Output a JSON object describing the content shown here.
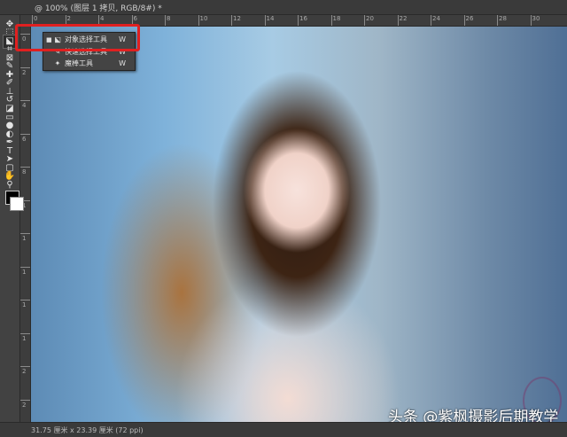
{
  "document": {
    "tab_title": "@ 100% (图层 1 拷贝, RGB/8#) *"
  },
  "ruler": {
    "top_labels": [
      "0",
      "2",
      "4",
      "6",
      "8",
      "10",
      "12",
      "14",
      "16",
      "18",
      "20",
      "22",
      "24",
      "26",
      "28",
      "30"
    ],
    "left_labels": [
      "0",
      "2",
      "4",
      "6",
      "8",
      "1",
      "1",
      "1",
      "1",
      "1",
      "2",
      "2"
    ]
  },
  "toolbar": {
    "tools": [
      {
        "name": "move-tool",
        "glyph": "✥"
      },
      {
        "name": "marquee-tool",
        "glyph": "⬚"
      },
      {
        "name": "object-selection-tool",
        "glyph": "⬕"
      },
      {
        "name": "crop-tool",
        "glyph": "⌗"
      },
      {
        "name": "frame-tool",
        "glyph": "⊠"
      },
      {
        "name": "eyedropper-tool",
        "glyph": "✎"
      },
      {
        "name": "healing-brush-tool",
        "glyph": "✚"
      },
      {
        "name": "brush-tool",
        "glyph": "✐"
      },
      {
        "name": "clone-stamp-tool",
        "glyph": "⊥"
      },
      {
        "name": "history-brush-tool",
        "glyph": "↺"
      },
      {
        "name": "eraser-tool",
        "glyph": "◪"
      },
      {
        "name": "gradient-tool",
        "glyph": "▭"
      },
      {
        "name": "blur-tool",
        "glyph": "●"
      },
      {
        "name": "dodge-tool",
        "glyph": "◐"
      },
      {
        "name": "pen-tool",
        "glyph": "✒"
      },
      {
        "name": "type-tool",
        "glyph": "T"
      },
      {
        "name": "path-selection-tool",
        "glyph": "➤"
      },
      {
        "name": "shape-tool",
        "glyph": "▢"
      },
      {
        "name": "hand-tool",
        "glyph": "✋"
      },
      {
        "name": "zoom-tool",
        "glyph": "⚲"
      },
      {
        "name": "more-tools",
        "glyph": "…"
      }
    ]
  },
  "flyout": {
    "items": [
      {
        "label": "对象选择工具",
        "key": "W",
        "glyph": "⬕",
        "selected": true
      },
      {
        "label": "快速选择工具",
        "key": "W",
        "glyph": "✎",
        "selected": false
      },
      {
        "label": "魔棒工具",
        "key": "W",
        "glyph": "✦",
        "selected": false
      }
    ]
  },
  "status": {
    "text": "31.75 厘米 x 23.39 厘米 (72 ppi)"
  },
  "watermark": {
    "text": "头条 @紫枫摄影后期教学"
  },
  "colors": {
    "highlight": "#e02020",
    "foreground": "#000000",
    "background": "#ffffff"
  }
}
